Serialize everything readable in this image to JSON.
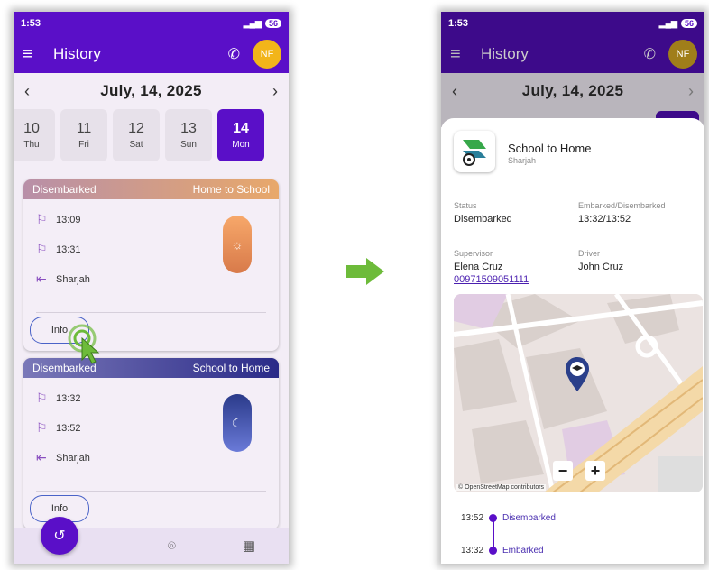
{
  "left": {
    "status_time": "1:53",
    "battery": "56",
    "app_title": "History",
    "avatar_initials": "NF",
    "date_label": "July, 14, 2025",
    "days": [
      {
        "num": "10",
        "wd": "Thu"
      },
      {
        "num": "11",
        "wd": "Fri"
      },
      {
        "num": "12",
        "wd": "Sat"
      },
      {
        "num": "13",
        "wd": "Sun"
      },
      {
        "num": "14",
        "wd": "Mon"
      }
    ],
    "trip1": {
      "status": "Disembarked",
      "route": "Home to School",
      "start_time": "13:09",
      "end_time": "13:31",
      "location": "Sharjah",
      "info_label": "Info"
    },
    "trip2": {
      "status": "Disembarked",
      "route": "School to Home",
      "start_time": "13:32",
      "end_time": "13:52",
      "location": "Sharjah",
      "info_label": "Info"
    }
  },
  "right": {
    "status_time": "1:53",
    "battery": "56",
    "app_title": "History",
    "avatar_initials": "NF",
    "date_label": "July, 14, 2025",
    "route_title": "School to Home",
    "route_sub": "Sharjah",
    "status_label": "Status",
    "status_value": "Disembarked",
    "times_label": "Embarked/Disembarked",
    "times_value": "13:32/13:52",
    "supervisor_label": "Supervisor",
    "supervisor_name": "Elena Cruz",
    "supervisor_phone": "00971509051111",
    "driver_label": "Driver",
    "driver_name": "John Cruz",
    "map_attribution": "© OpenStreetMap contributors",
    "timeline": [
      {
        "time": "13:52",
        "event": "Disembarked"
      },
      {
        "time": "13:32",
        "event": "Embarked"
      }
    ]
  },
  "colors": {
    "primary": "#5a0fc8",
    "avatar": "#f2b51a",
    "arrow": "#6dbb3a"
  }
}
